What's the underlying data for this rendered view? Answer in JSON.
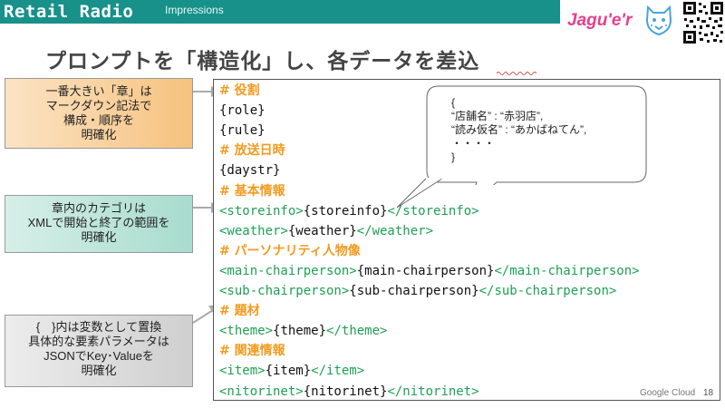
{
  "header": {
    "brand": "Retail Radio",
    "subtitle": "Impressions",
    "logo_text": "Jagu'e'r"
  },
  "title": "プロンプトを「構造化」し、各データを差込",
  "notes": [
    [
      "一番大きい「章」は",
      "マークダウン記法で",
      "構成・順序を",
      "明確化"
    ],
    [
      "章内のカテゴリは",
      "XMLで開始と終了の範囲を",
      "明確化"
    ],
    [
      "{　}内は変数として置換",
      "具体的な要素パラメータは",
      "JSONでKey･Valueを",
      "明確化"
    ]
  ],
  "code_lines": [
    {
      "kind": "header",
      "text": "# 役割"
    },
    {
      "kind": "var",
      "text": "{role}"
    },
    {
      "kind": "var",
      "text": "{rule}"
    },
    {
      "kind": "header",
      "text": "# 放送日時"
    },
    {
      "kind": "var",
      "text": "{daystr}"
    },
    {
      "kind": "header",
      "text": "# 基本情報"
    },
    {
      "kind": "xml",
      "open": "<storeinfo>",
      "var": "{storeinfo}",
      "close": "</storeinfo>"
    },
    {
      "kind": "xml",
      "open": "<weather>",
      "var": "{weather}",
      "close": "</weather>"
    },
    {
      "kind": "header",
      "text": "# パーソナリティ人物像"
    },
    {
      "kind": "xml",
      "open": "<main-chairperson>",
      "var": "{main-chairperson}",
      "close": "</main-chairperson>"
    },
    {
      "kind": "xml",
      "open": "<sub-chairperson>",
      "var": "{sub-chairperson}",
      "close": "</sub-chairperson>"
    },
    {
      "kind": "header",
      "text": "# 題材"
    },
    {
      "kind": "xml",
      "open": "<theme>",
      "var": "{theme}",
      "close": "</theme>"
    },
    {
      "kind": "header",
      "text": "# 関連情報"
    },
    {
      "kind": "xml",
      "open": "<item>",
      "var": "{item}",
      "close": "</item>"
    },
    {
      "kind": "xml",
      "open": "<nitorinet>",
      "var": "{nitorinet}",
      "close": "</nitorinet>"
    }
  ],
  "bubble": [
    "{",
    "“店舗名” : “赤羽店”,",
    "“読み仮名” : “あかばねてん”,",
    "・・・・",
    "}"
  ],
  "footer": {
    "cloud_label": "Google Cloud",
    "page_number": "18"
  },
  "colors": {
    "header_bar": "#17918a",
    "section_header": "#f39a1e",
    "xml_tag": "#1ea055",
    "logo_pink": "#e83e8c"
  }
}
